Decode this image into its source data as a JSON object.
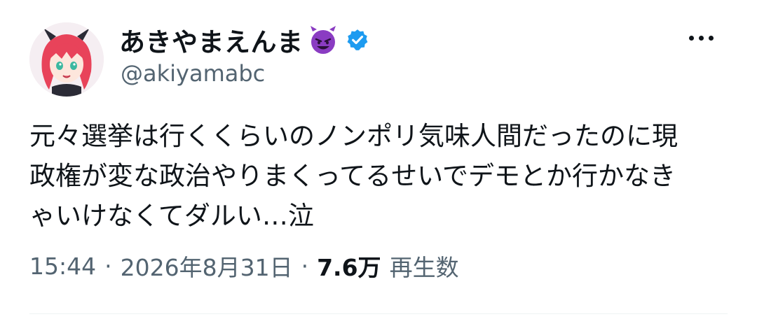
{
  "author": {
    "display_name": "あきやまえんま",
    "name_emoji": "smiling-devil-emoji",
    "verified_icon": "verified-badge-icon",
    "handle": "@akiyamabc"
  },
  "tweet": {
    "lines": [
      "元々選挙は行くくらいのノンポリ気味人間だったのに現",
      "政権が変な政治やりまくってるせいでデモとか行かなき",
      "ゃいけなくてダルい…泣"
    ]
  },
  "meta": {
    "time": "15:44",
    "date": "2026年8月31日",
    "separator": "·",
    "views_count": "7.6万",
    "views_label": "再生数"
  },
  "colors": {
    "text": "#0f1419",
    "secondary": "#536471",
    "verified": "#1d9bf0",
    "emoji": "#8a3cc2"
  },
  "icons": {
    "more": "more-horizontal-icon"
  }
}
